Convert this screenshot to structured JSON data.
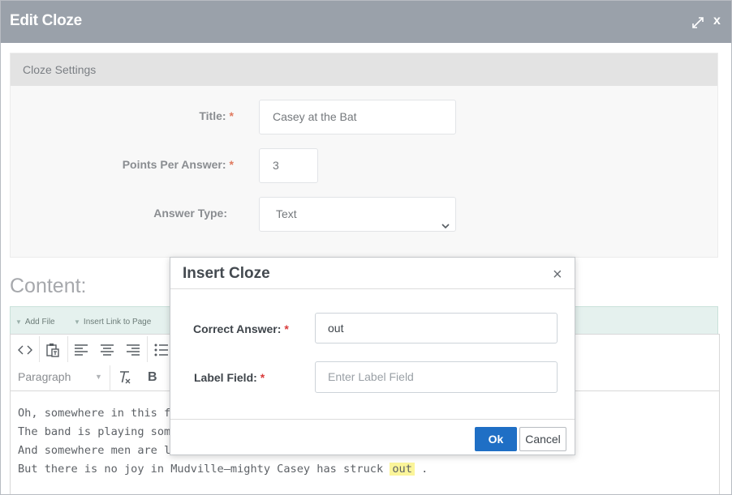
{
  "window": {
    "title": "Edit Cloze",
    "close_label": "x"
  },
  "settings": {
    "header": "Cloze Settings",
    "title_label": "Title:",
    "title_value": "Casey at the Bat",
    "points_label": "Points Per Answer:",
    "points_value": "3",
    "answer_type_label": "Answer Type:",
    "answer_type_value": "Text",
    "required_mark": "*"
  },
  "content": {
    "heading": "Content:",
    "toolbar_links": {
      "add_file": "Add File",
      "insert_link": "Insert Link to Page"
    },
    "format_select": "Paragraph",
    "bold_label": "B",
    "lines": [
      "Oh, somewhere in this fave",
      "The band is playing somew",
      "And somewhere men are la",
      "But there is no joy in Mudville—mighty Casey has struck"
    ],
    "highlight": "out",
    "trailing": " ."
  },
  "modal": {
    "title": "Insert Cloze",
    "close_label": "×",
    "correct_answer_label": "Correct Answer:",
    "correct_answer_value": "out",
    "label_field_label": "Label Field:",
    "label_field_placeholder": "Enter Label Field",
    "required_mark": "*",
    "ok_label": "Ok",
    "cancel_label": "Cancel"
  },
  "icons": {
    "expand": "expand-icon",
    "close": "close-icon",
    "source": "code-view-icon",
    "paste": "paste-text-icon",
    "align_left": "align-left-icon",
    "align_center": "align-center-icon",
    "align_right": "align-right-icon",
    "bullet_list": "bullet-list-icon",
    "clear_format": "clear-formatting-icon"
  },
  "colors": {
    "titlebar": "#9aa1aa",
    "ok_button": "#1f6fc5",
    "highlight": "#fbf59a",
    "required": "#d93b3b"
  }
}
